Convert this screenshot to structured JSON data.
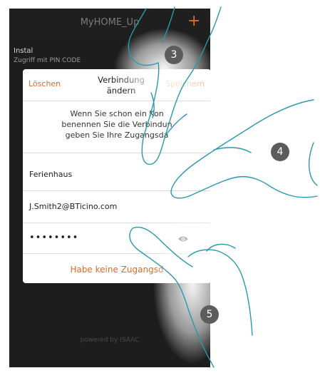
{
  "app": {
    "title": "MyHOME_Up",
    "add_icon": "plus-icon"
  },
  "background_row": {
    "title": "Instal",
    "subtitle": "Zugriff mit PIN CODE"
  },
  "dialog": {
    "delete_label": "Löschen",
    "title_line1": "Verbindung",
    "title_line2": "ändern",
    "save_label": "Speichern",
    "message_line1": "Wenn Sie schon ein Kon",
    "message_line2": "benennen Sie die Verbindun",
    "message_line3": "geben Sie Ihre Zugangsda",
    "name_value": "Ferienhaus",
    "email_value": "J.Smith2@BTicino.com",
    "password_value": "••••••••",
    "show_password_icon": "eye-icon",
    "no_access_link": "Habe keine Zugangsd"
  },
  "footer": {
    "text": "powered by ISAAC"
  },
  "callouts": {
    "step3": "3",
    "step4": "4",
    "step5": "5"
  },
  "colors": {
    "accent": "#e06a2a",
    "phone_bg": "#1d1d1d",
    "badge": "#5c5c5c"
  }
}
